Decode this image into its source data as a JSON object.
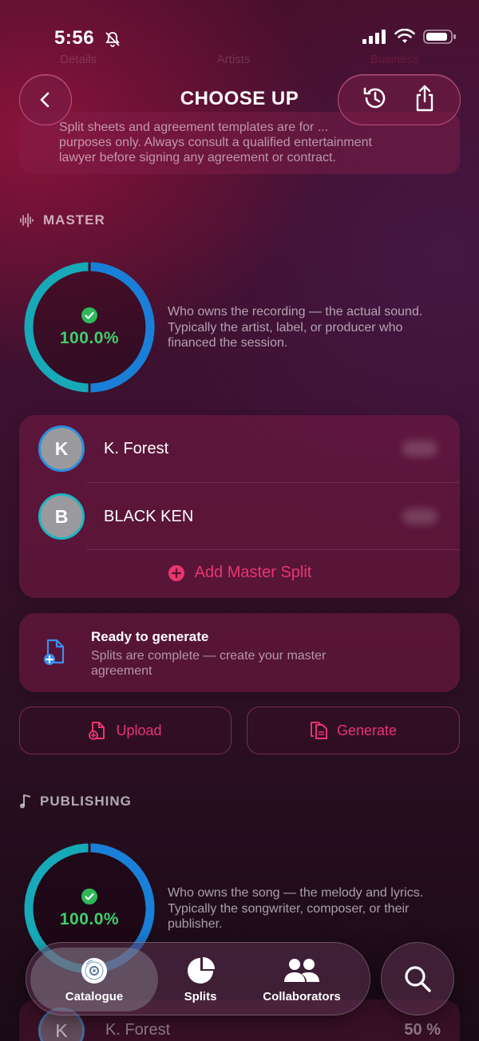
{
  "status_bar": {
    "time": "5:56"
  },
  "ghost_tabs": [
    "Details",
    "Artists",
    "Business"
  ],
  "header": {
    "title": "CHOOSE UP"
  },
  "disclaimer": {
    "line1": "Split sheets and agreement templates are for ...",
    "line2": "purposes only. Always consult a qualified entertainment",
    "line3": "lawyer before signing any agreement or contract."
  },
  "master": {
    "label": "MASTER",
    "percent": "100.0%",
    "percent_value": 100,
    "description": "Who owns the recording — the actual sound. Typically the artist, label, or producer who financed the session.",
    "splits": [
      {
        "initial": "K",
        "name": "K. Forest"
      },
      {
        "initial": "B",
        "name": "BLACK KEN"
      }
    ],
    "add_label": "Add Master Split",
    "ready": {
      "title": "Ready to generate",
      "subtitle": "Splits are complete — create your master agreement"
    },
    "upload_label": "Upload",
    "generate_label": "Generate"
  },
  "publishing": {
    "label": "PUBLISHING",
    "percent": "100.0%",
    "percent_value": 100,
    "description": "Who owns the song — the melody and lyrics. Typically the songwriter, composer, or their publisher.",
    "first_split": {
      "initial": "K",
      "name": "K. Forest",
      "percent": "50 %"
    }
  },
  "tabbar": {
    "items": [
      {
        "label": "Catalogue",
        "icon": "disc-icon",
        "active": true
      },
      {
        "label": "Splits",
        "icon": "pie-chart-icon",
        "active": false
      },
      {
        "label": "Collaborators",
        "icon": "people-icon",
        "active": false
      }
    ]
  },
  "colors": {
    "accent": "#e8366f",
    "success": "#3ed06b",
    "ring_blue": "#1a7fd8",
    "ring_teal": "#17a9b8"
  }
}
